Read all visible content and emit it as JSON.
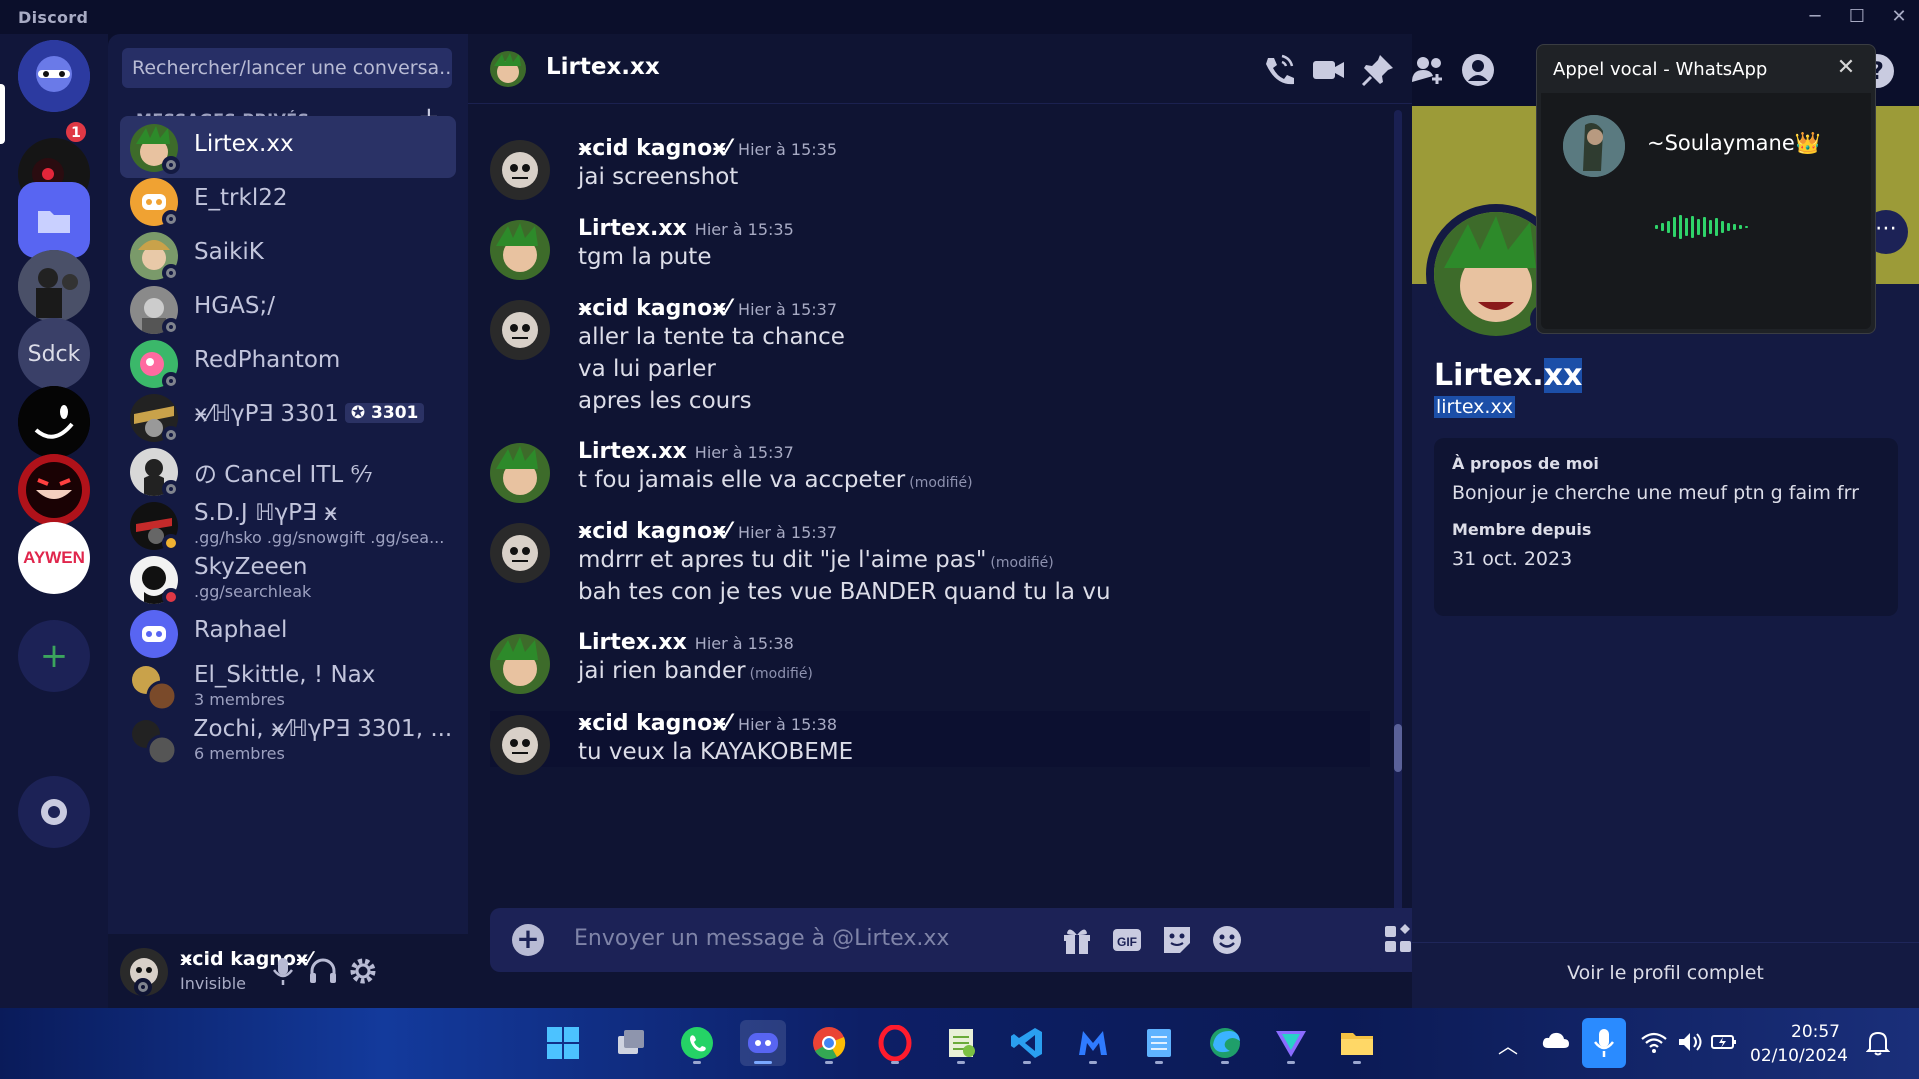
{
  "app": {
    "title": "Discord"
  },
  "rail": {
    "badge": "1",
    "servers": [
      "home",
      "server-red-eye",
      "folder",
      "server-group",
      "Sdck",
      "server-smile",
      "server-grin",
      "AYWEN",
      "add-server",
      "discover"
    ],
    "sdck_label": "Sdck",
    "aywen_label": "AYWEN"
  },
  "dm": {
    "search_placeholder": "Rechercher/lancer une conversa...",
    "header": "MESSAGES PRIVÉS",
    "items": [
      {
        "name": "Lirtex.xx",
        "sub": ""
      },
      {
        "name": "E_trkl22",
        "sub": ""
      },
      {
        "name": "SaikiK",
        "sub": ""
      },
      {
        "name": "HGAS;/",
        "sub": ""
      },
      {
        "name": "RedPhantom",
        "sub": ""
      },
      {
        "name": "ӿ⁄ℍγΡ∃ 3301",
        "tag": "3301",
        "sub": ""
      },
      {
        "name": "の Cancel ITL ⁶⁄₇",
        "sub": ""
      },
      {
        "name": "S.D.J ℍγΡ∃ ӿ",
        "sub": ".gg/hsko .gg/snowgift .gg/sea..."
      },
      {
        "name": "SkyZeeen",
        "sub": ".gg/searchleak"
      },
      {
        "name": "Raphael",
        "sub": ""
      },
      {
        "name": "El_Skittle, ! Nax",
        "sub": "3 membres"
      },
      {
        "name": "Ꮓochi, ӿ⁄ℍγΡ∃ 3301, ...",
        "sub": "6 membres"
      }
    ]
  },
  "user": {
    "name": "ӿcid kagnoӿ⁄",
    "status": "Invisible"
  },
  "chat": {
    "title": "Lirtex.xx",
    "composer_placeholder": "Envoyer un message à @Lirtex.xx",
    "edited": "(modifié)",
    "messages": [
      {
        "author": "ӿcid kagnoӿ⁄",
        "time": "Hier à 15:35",
        "lines": [
          "jai screenshot"
        ]
      },
      {
        "author": "Lirtex.xx",
        "time": "Hier à 15:35",
        "lines": [
          "tgm la pute"
        ]
      },
      {
        "author": "ӿcid kagnoӿ⁄",
        "time": "Hier à 15:37",
        "lines": [
          "aller la tente ta chance",
          "va lui parler",
          "apres les cours"
        ]
      },
      {
        "author": "Lirtex.xx",
        "time": "Hier à 15:37",
        "lines": [
          "t fou jamais elle va accpeter"
        ]
      },
      {
        "author": "ӿcid kagnoӿ⁄",
        "time": "Hier à 15:37",
        "lines": [
          "mdrrr et apres tu dit \"je l'aime pas\"",
          "bah tes con je tes vue BANDER quand tu la vu"
        ]
      },
      {
        "author": "Lirtex.xx",
        "time": "Hier à 15:38",
        "lines": [
          "jai rien bander"
        ]
      },
      {
        "author": "ӿcid kagnoӿ⁄",
        "time": "Hier à 15:38",
        "lines": [
          "tu veux la KAYAKOBEME"
        ]
      }
    ]
  },
  "profile": {
    "name_plain": "Lirtex.",
    "name_selected": "xx",
    "username": "lirtex.xx",
    "about_label": "À propos de moi",
    "about_text": "Bonjour je cherche une meuf ptn g faim frr",
    "member_label": "Membre depuis",
    "member_since": "31 oct. 2023",
    "full_profile": "Voir le profil complet"
  },
  "whatsapp": {
    "title": "Appel vocal - WhatsApp",
    "caller": "~Soulaymane👑"
  },
  "taskbar": {
    "time": "20:57",
    "date": "02/10/2024",
    "apps": [
      "start",
      "task-view",
      "whatsapp",
      "discord",
      "chrome",
      "opera",
      "notepad-plus",
      "vscode",
      "malwarebytes",
      "notepad",
      "edge",
      "proton-vpn",
      "file-explorer"
    ]
  },
  "colors": {
    "accent": "#5865f2",
    "banner": "#9c9b38",
    "dnd": "#e03845",
    "selection": "#1c4fa8"
  }
}
